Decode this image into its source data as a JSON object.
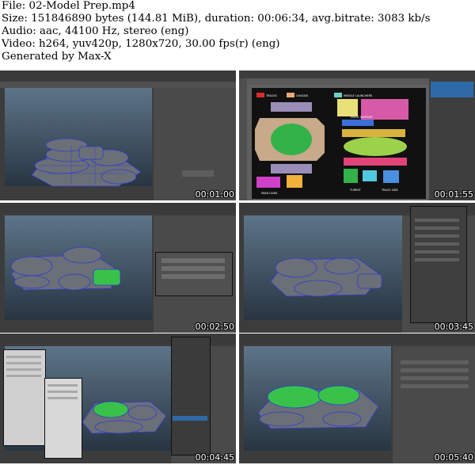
{
  "info": {
    "file": "File: 02-Model Prep.mp4",
    "size": "Size: 151846890 bytes (144.81 MiB), duration: 00:06:34, avg.bitrate: 3083 kb/s",
    "audio": "Audio: aac, 44100 Hz, stereo (eng)",
    "video": "Video: h264, yuv420p, 1280x720, 30.00 fps(r) (eng)",
    "generated": "Generated by Max-X"
  },
  "thumbnails": [
    {
      "timestamp": "00:01:00"
    },
    {
      "timestamp": "00:01:55"
    },
    {
      "timestamp": "00:02:50"
    },
    {
      "timestamp": "00:03:45"
    },
    {
      "timestamp": "00:04:45"
    },
    {
      "timestamp": "00:05:40"
    }
  ],
  "uv_labels": [
    "TRACKS",
    "CHASSIS",
    "MISSILE LAUNCHERS",
    "TRACK SUPPORT",
    "TURRET",
    "TRACK SIDE",
    "MAIN GUNS"
  ],
  "colors": {
    "viewport_top": "#5d7488",
    "viewport_bottom": "#283542",
    "ui_panel": "#464646",
    "model_body": "#6b6f78",
    "wireframe": "#2f3bd0",
    "selection": "#38c24a"
  }
}
